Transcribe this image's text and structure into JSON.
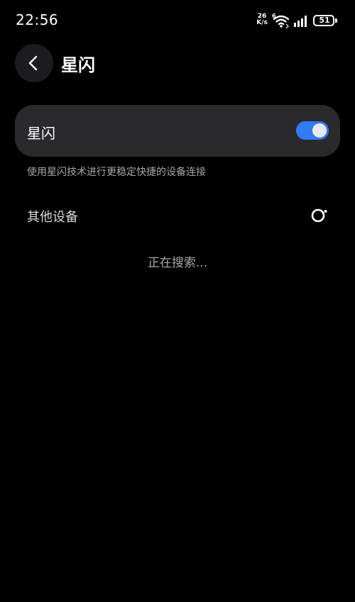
{
  "status_bar": {
    "time": "22:56",
    "net_speed_value": "26",
    "net_speed_unit": "K/s",
    "wifi_badge": "6",
    "battery_level": "51"
  },
  "header": {
    "title": "星闪"
  },
  "toggle_card": {
    "label": "星闪",
    "enabled": true
  },
  "description": "使用星闪技术进行更稳定快捷的设备连接",
  "other_devices": {
    "label": "其他设备",
    "status": "正在搜索..."
  },
  "colors": {
    "background": "#000000",
    "card": "#2a2a2d",
    "toggle_on": "#2f7cf6",
    "secondary_text": "#a7a7ab"
  }
}
